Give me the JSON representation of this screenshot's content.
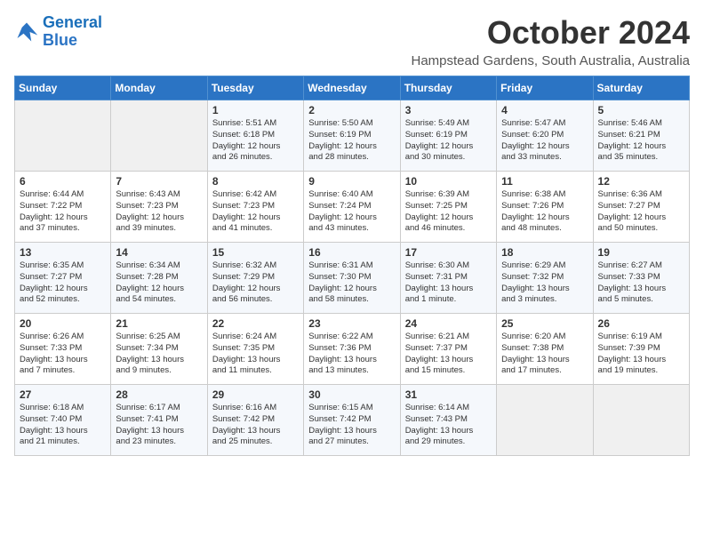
{
  "header": {
    "logo_line1": "General",
    "logo_line2": "Blue",
    "month": "October 2024",
    "location": "Hampstead Gardens, South Australia, Australia"
  },
  "days_of_week": [
    "Sunday",
    "Monday",
    "Tuesday",
    "Wednesday",
    "Thursday",
    "Friday",
    "Saturday"
  ],
  "weeks": [
    [
      {
        "day": "",
        "content": ""
      },
      {
        "day": "",
        "content": ""
      },
      {
        "day": "1",
        "content": "Sunrise: 5:51 AM\nSunset: 6:18 PM\nDaylight: 12 hours\nand 26 minutes."
      },
      {
        "day": "2",
        "content": "Sunrise: 5:50 AM\nSunset: 6:19 PM\nDaylight: 12 hours\nand 28 minutes."
      },
      {
        "day": "3",
        "content": "Sunrise: 5:49 AM\nSunset: 6:19 PM\nDaylight: 12 hours\nand 30 minutes."
      },
      {
        "day": "4",
        "content": "Sunrise: 5:47 AM\nSunset: 6:20 PM\nDaylight: 12 hours\nand 33 minutes."
      },
      {
        "day": "5",
        "content": "Sunrise: 5:46 AM\nSunset: 6:21 PM\nDaylight: 12 hours\nand 35 minutes."
      }
    ],
    [
      {
        "day": "6",
        "content": "Sunrise: 6:44 AM\nSunset: 7:22 PM\nDaylight: 12 hours\nand 37 minutes."
      },
      {
        "day": "7",
        "content": "Sunrise: 6:43 AM\nSunset: 7:23 PM\nDaylight: 12 hours\nand 39 minutes."
      },
      {
        "day": "8",
        "content": "Sunrise: 6:42 AM\nSunset: 7:23 PM\nDaylight: 12 hours\nand 41 minutes."
      },
      {
        "day": "9",
        "content": "Sunrise: 6:40 AM\nSunset: 7:24 PM\nDaylight: 12 hours\nand 43 minutes."
      },
      {
        "day": "10",
        "content": "Sunrise: 6:39 AM\nSunset: 7:25 PM\nDaylight: 12 hours\nand 46 minutes."
      },
      {
        "day": "11",
        "content": "Sunrise: 6:38 AM\nSunset: 7:26 PM\nDaylight: 12 hours\nand 48 minutes."
      },
      {
        "day": "12",
        "content": "Sunrise: 6:36 AM\nSunset: 7:27 PM\nDaylight: 12 hours\nand 50 minutes."
      }
    ],
    [
      {
        "day": "13",
        "content": "Sunrise: 6:35 AM\nSunset: 7:27 PM\nDaylight: 12 hours\nand 52 minutes."
      },
      {
        "day": "14",
        "content": "Sunrise: 6:34 AM\nSunset: 7:28 PM\nDaylight: 12 hours\nand 54 minutes."
      },
      {
        "day": "15",
        "content": "Sunrise: 6:32 AM\nSunset: 7:29 PM\nDaylight: 12 hours\nand 56 minutes."
      },
      {
        "day": "16",
        "content": "Sunrise: 6:31 AM\nSunset: 7:30 PM\nDaylight: 12 hours\nand 58 minutes."
      },
      {
        "day": "17",
        "content": "Sunrise: 6:30 AM\nSunset: 7:31 PM\nDaylight: 13 hours\nand 1 minute."
      },
      {
        "day": "18",
        "content": "Sunrise: 6:29 AM\nSunset: 7:32 PM\nDaylight: 13 hours\nand 3 minutes."
      },
      {
        "day": "19",
        "content": "Sunrise: 6:27 AM\nSunset: 7:33 PM\nDaylight: 13 hours\nand 5 minutes."
      }
    ],
    [
      {
        "day": "20",
        "content": "Sunrise: 6:26 AM\nSunset: 7:33 PM\nDaylight: 13 hours\nand 7 minutes."
      },
      {
        "day": "21",
        "content": "Sunrise: 6:25 AM\nSunset: 7:34 PM\nDaylight: 13 hours\nand 9 minutes."
      },
      {
        "day": "22",
        "content": "Sunrise: 6:24 AM\nSunset: 7:35 PM\nDaylight: 13 hours\nand 11 minutes."
      },
      {
        "day": "23",
        "content": "Sunrise: 6:22 AM\nSunset: 7:36 PM\nDaylight: 13 hours\nand 13 minutes."
      },
      {
        "day": "24",
        "content": "Sunrise: 6:21 AM\nSunset: 7:37 PM\nDaylight: 13 hours\nand 15 minutes."
      },
      {
        "day": "25",
        "content": "Sunrise: 6:20 AM\nSunset: 7:38 PM\nDaylight: 13 hours\nand 17 minutes."
      },
      {
        "day": "26",
        "content": "Sunrise: 6:19 AM\nSunset: 7:39 PM\nDaylight: 13 hours\nand 19 minutes."
      }
    ],
    [
      {
        "day": "27",
        "content": "Sunrise: 6:18 AM\nSunset: 7:40 PM\nDaylight: 13 hours\nand 21 minutes."
      },
      {
        "day": "28",
        "content": "Sunrise: 6:17 AM\nSunset: 7:41 PM\nDaylight: 13 hours\nand 23 minutes."
      },
      {
        "day": "29",
        "content": "Sunrise: 6:16 AM\nSunset: 7:42 PM\nDaylight: 13 hours\nand 25 minutes."
      },
      {
        "day": "30",
        "content": "Sunrise: 6:15 AM\nSunset: 7:42 PM\nDaylight: 13 hours\nand 27 minutes."
      },
      {
        "day": "31",
        "content": "Sunrise: 6:14 AM\nSunset: 7:43 PM\nDaylight: 13 hours\nand 29 minutes."
      },
      {
        "day": "",
        "content": ""
      },
      {
        "day": "",
        "content": ""
      }
    ]
  ]
}
